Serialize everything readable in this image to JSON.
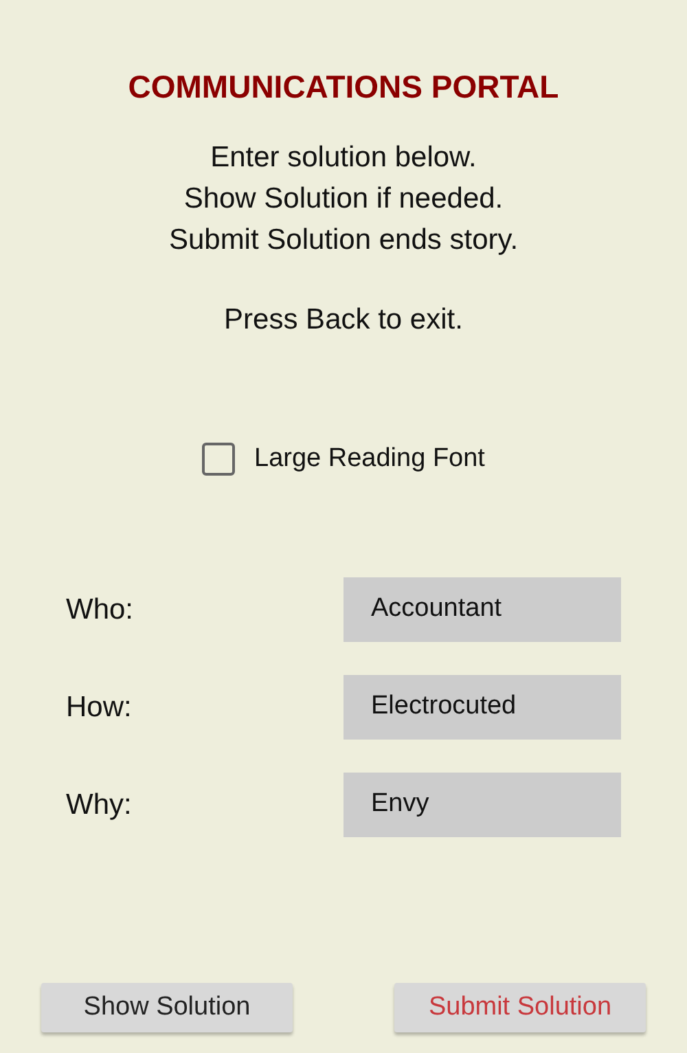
{
  "title": "COMMUNICATIONS PORTAL",
  "instructions": [
    "Enter solution below.",
    "Show Solution if needed.",
    "Submit Solution ends story."
  ],
  "exit_hint": "Press Back to exit.",
  "large_font": {
    "label": "Large Reading Font",
    "checked": false
  },
  "fields": [
    {
      "label": "Who:",
      "value": "Accountant"
    },
    {
      "label": "How:",
      "value": "Electrocuted"
    },
    {
      "label": "Why:",
      "value": "Envy"
    }
  ],
  "buttons": [
    {
      "label": "Show Solution",
      "kind": "default"
    },
    {
      "label": "Submit Solution",
      "kind": "submit"
    }
  ]
}
